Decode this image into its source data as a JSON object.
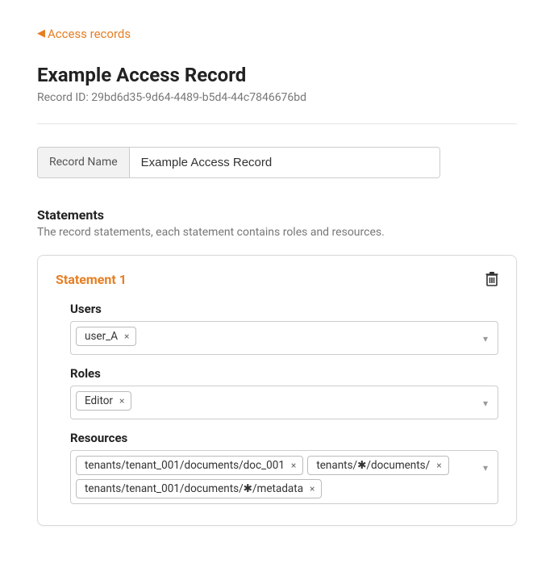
{
  "backLink": "Access records",
  "pageTitle": "Example Access Record",
  "recordIdLabel": "Record ID:",
  "recordId": "29bd6d35-9d64-4489-b5d4-44c7846676bd",
  "recordNameLabel": "Record Name",
  "recordNameValue": "Example Access Record",
  "statementsTitle": "Statements",
  "statementsDesc": "The record statements, each statement contains roles and resources.",
  "statement": {
    "title": "Statement 1",
    "usersLabel": "Users",
    "users": [
      "user_A"
    ],
    "rolesLabel": "Roles",
    "roles": [
      "Editor"
    ],
    "resourcesLabel": "Resources",
    "resources": [
      "tenants/tenant_001/documents/doc_001",
      "tenants/✱/documents/",
      "tenants/tenant_001/documents/✱/metadata"
    ]
  }
}
